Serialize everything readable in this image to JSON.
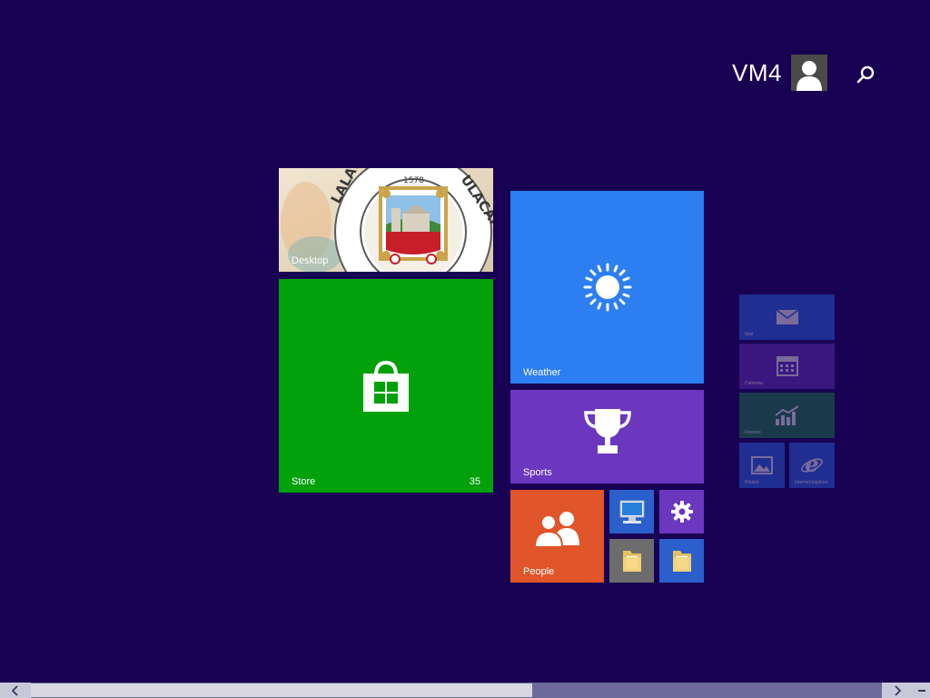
{
  "user": {
    "name": "VM4"
  },
  "tiles": {
    "desktop": {
      "label": "Desktop",
      "seal_year": "1578",
      "seal_text_left": "LALAWIG",
      "seal_text_right": "ULACAN"
    },
    "store": {
      "label": "Store",
      "badge": "35"
    },
    "weather": {
      "label": "Weather"
    },
    "sports": {
      "label": "Sports"
    },
    "people": {
      "label": "People"
    },
    "mail": {
      "label": "Mail"
    },
    "calendar": {
      "label": "Calendar"
    },
    "finance": {
      "label": "Finance"
    },
    "photos": {
      "label": "Photos"
    },
    "ie": {
      "label": "Internet Explorer"
    }
  },
  "colors": {
    "background": "#180052",
    "store": "#00a10a",
    "weather": "#2d7ef0",
    "sports": "#6a37be",
    "people": "#e0552a"
  }
}
